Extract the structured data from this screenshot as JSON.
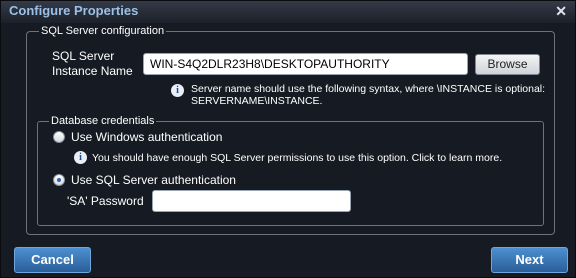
{
  "dialog": {
    "title": "Configure Properties",
    "close_glyph": "✕"
  },
  "sql_server": {
    "legend": "SQL Server configuration",
    "instance_label_1": "SQL Server",
    "instance_label_2": "Instance Name",
    "instance_value": "WIN-S4Q2DLR23H8\\DESKTOPAUTHORITY",
    "browse_label": "Browse",
    "hint_line_1": "Server name should use the following syntax, where \\INSTANCE is optional:",
    "hint_line_2": "SERVERNAME\\INSTANCE."
  },
  "credentials": {
    "legend": "Database credentials",
    "windows_auth_label": "Use Windows authentication",
    "windows_auth_checked": false,
    "windows_hint": "You should have enough SQL Server permissions to use this option. Click to learn more.",
    "sql_auth_label": "Use SQL Server authentication",
    "sql_auth_checked": true,
    "sa_password_label": "'SA' Password",
    "sa_password_value": ""
  },
  "footer": {
    "cancel_label": "Cancel",
    "next_label": "Next"
  },
  "icons": {
    "info": "info-icon",
    "close": "close-icon"
  },
  "colors": {
    "background": "#161a22",
    "title": "#9cc0e6",
    "button_blue": "#2a5e98"
  }
}
